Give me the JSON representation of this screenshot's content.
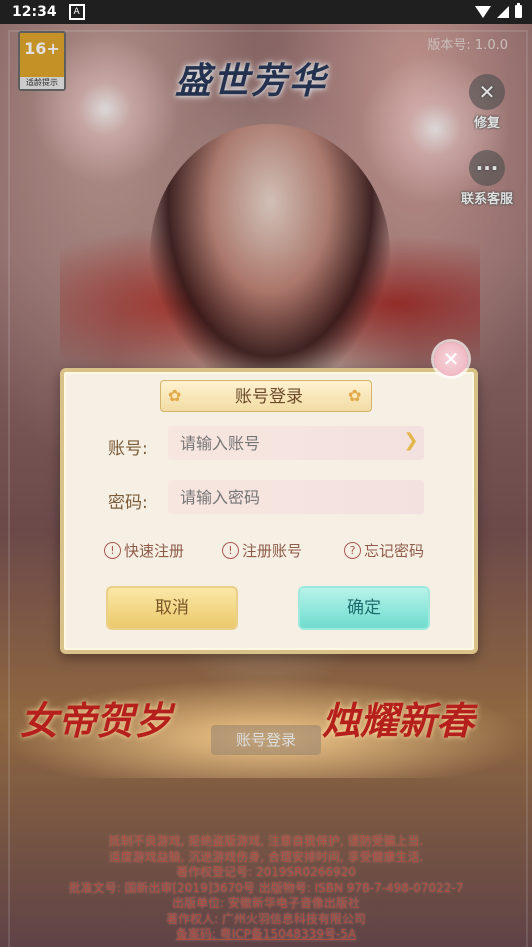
{
  "status_bar": {
    "time": "12:34",
    "notification_icon": "A"
  },
  "age_badge": {
    "rating": "16+",
    "label": "适龄提示"
  },
  "version": "版本号: 1.0.0",
  "logo_text": "盛世芳华",
  "side_buttons": [
    {
      "label": "修复",
      "icon": "wrench-icon"
    },
    {
      "label": "联系客服",
      "icon": "chat-icon"
    }
  ],
  "dialog": {
    "title": "账号登录",
    "account": {
      "label": "账号:",
      "placeholder": "请输入账号"
    },
    "password": {
      "label": "密码:",
      "placeholder": "请输入密码"
    },
    "links": [
      {
        "icon": "!",
        "label": "快速注册"
      },
      {
        "icon": "!",
        "label": "注册账号"
      },
      {
        "icon": "?",
        "label": "忘记密码"
      }
    ],
    "cancel": "取消",
    "confirm": "确定"
  },
  "banner": {
    "left": "女帝贺岁",
    "right": "烛耀新春",
    "account_login": "账号登录"
  },
  "footer": [
    "抵制不良游戏, 拒绝盗版游戏, 注意自我保护, 谨防受骗上当.",
    "适度游戏益脑, 沉迷游戏伤身, 合理安排时间, 享受健康生活.",
    "著作权登记号: 2019SR0266920",
    "批准文号: 国新出审[2019]3670号 出版物号: ISBN 978-7-498-07022-7",
    "出版单位: 安徽新华电子音像出版社",
    "著作权人: 广州火羽信息科技有限公司",
    "备案码: 粤ICP备15048339号-5A"
  ]
}
